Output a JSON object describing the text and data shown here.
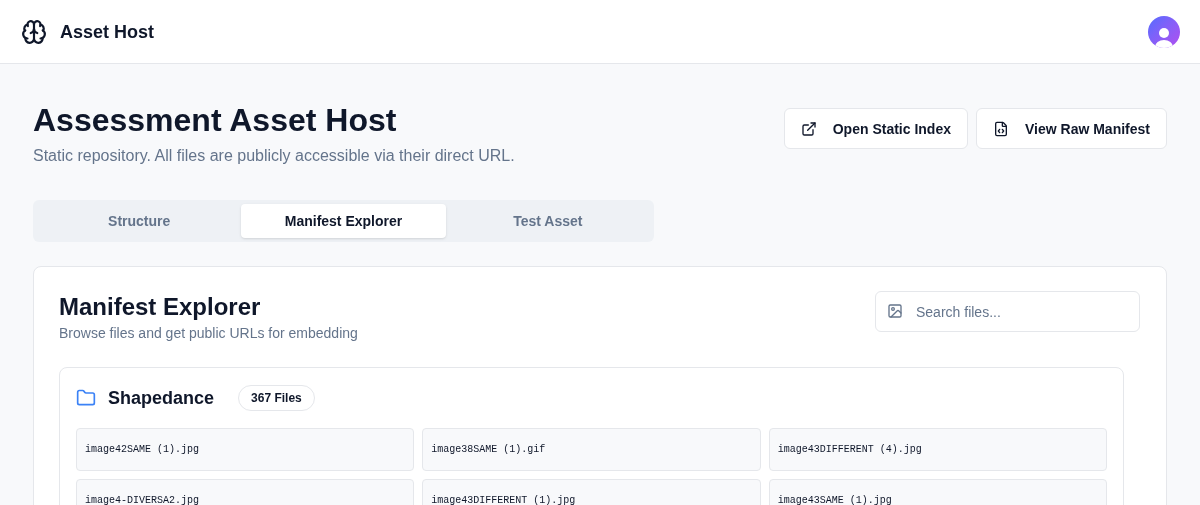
{
  "header": {
    "brand": "Asset Host"
  },
  "page": {
    "title": "Assessment Asset Host",
    "subtitle": "Static repository. All files are publicly accessible via their direct URL."
  },
  "actions": [
    {
      "kind": "external",
      "label": "Open Static Index"
    },
    {
      "kind": "file",
      "label": "View Raw Manifest"
    }
  ],
  "tabs": [
    {
      "label": "Structure",
      "selected": false
    },
    {
      "label": "Manifest Explorer",
      "selected": true
    },
    {
      "label": "Test Asset",
      "selected": false
    }
  ],
  "explorer": {
    "title": "Manifest Explorer",
    "description": "Browse files and get public URLs for embedding",
    "search": {
      "placeholder": "Search files..."
    },
    "folder": {
      "name": "Shapedance",
      "count": "367 Files",
      "files": [
        "image42SAME (1).jpg",
        "image38SAME (1).gif",
        "image43DIFFERENT (4).jpg",
        "image4-DIVERSA2.jpg",
        "image43DIFFERENT (1).jpg",
        "image43SAME (1).jpg"
      ]
    }
  }
}
